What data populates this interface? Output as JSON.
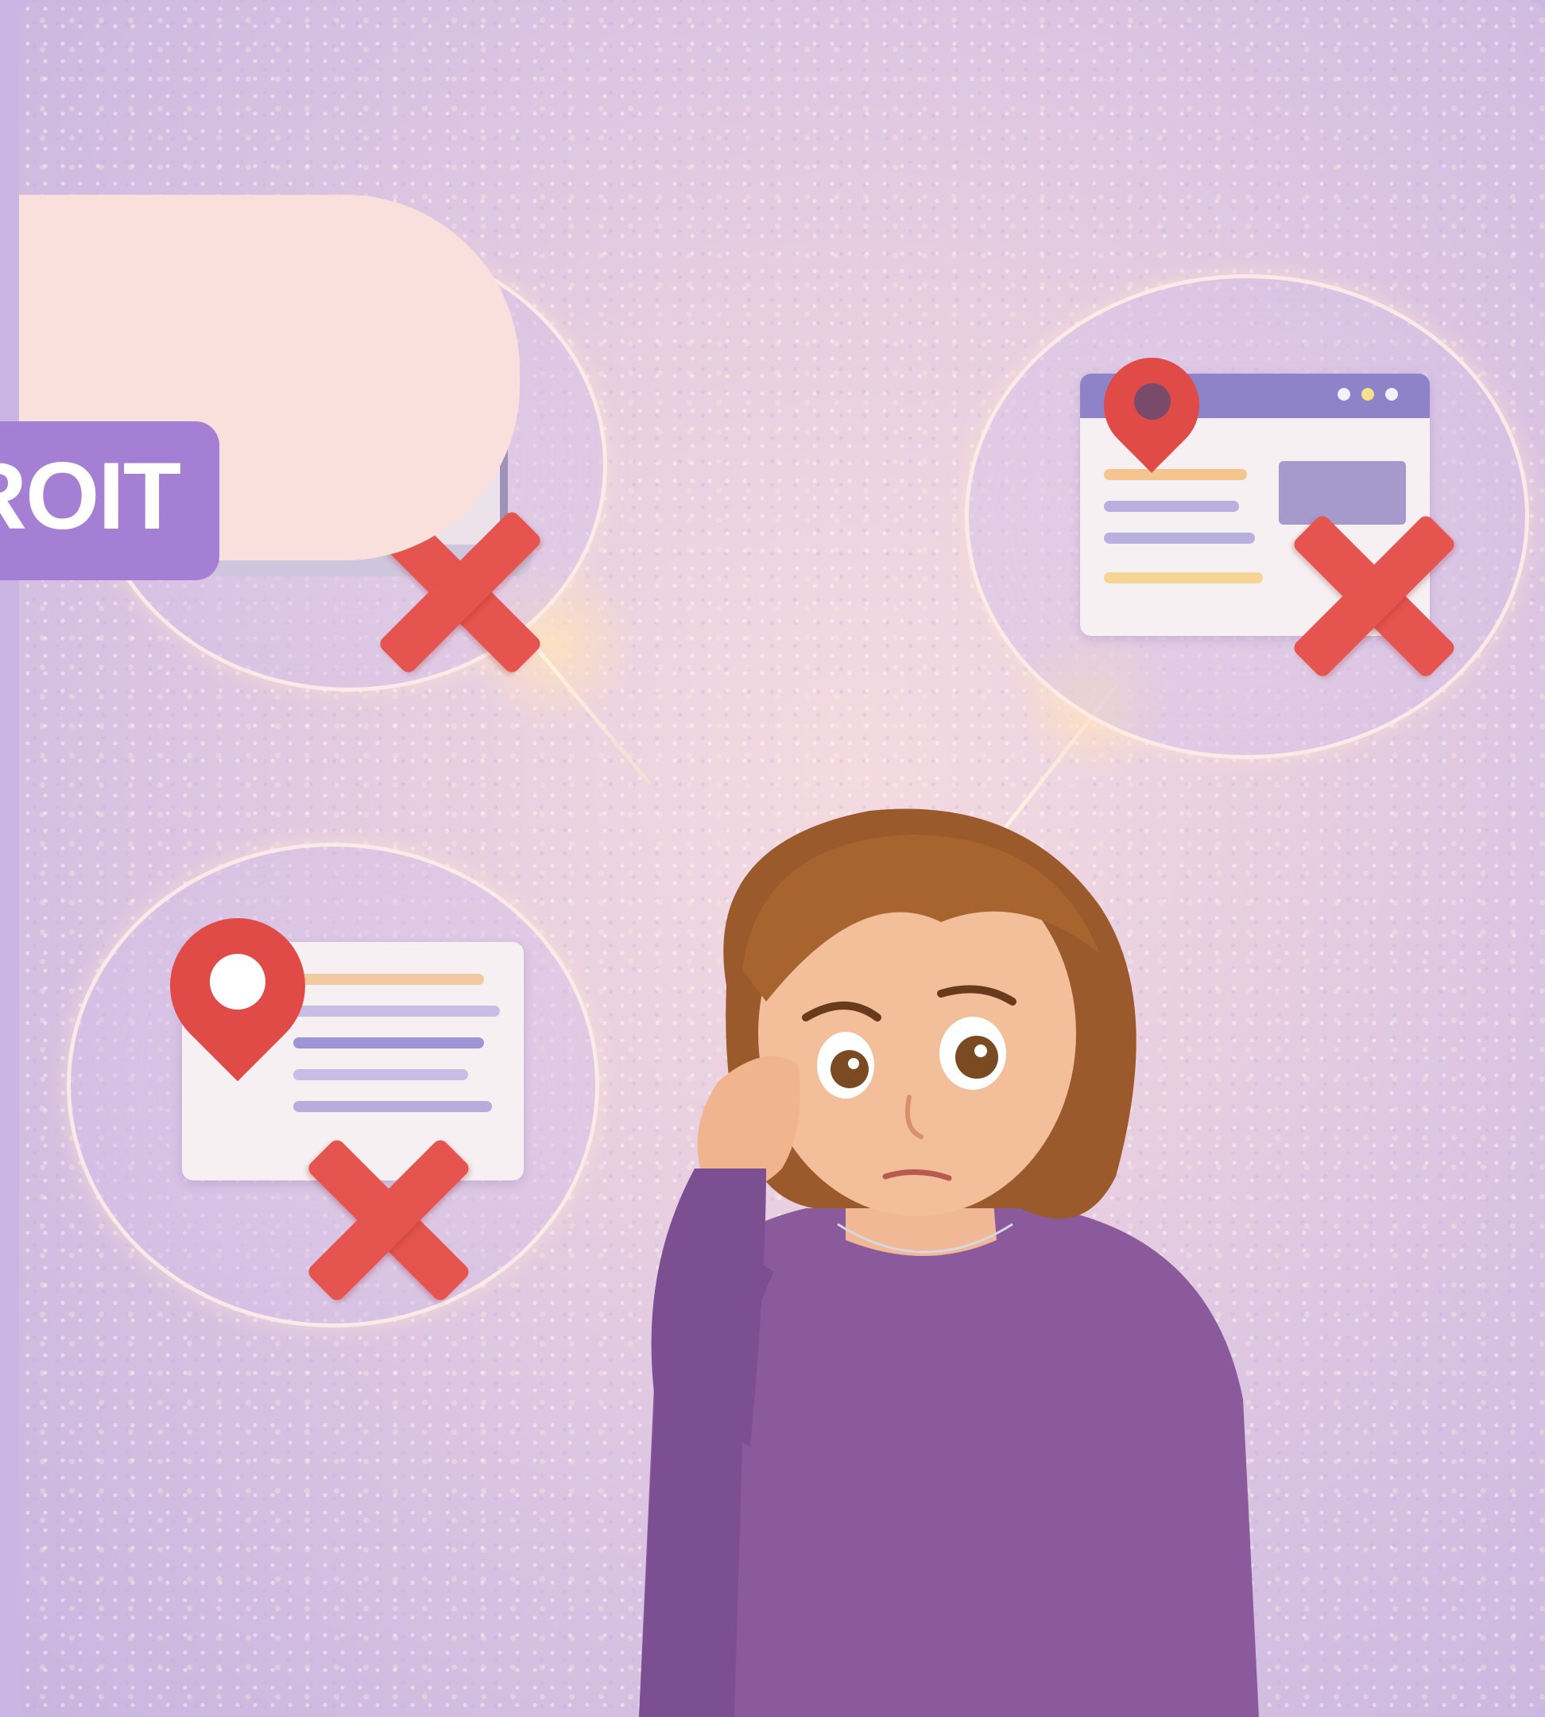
{
  "banner": {
    "label": "ROIT"
  },
  "illustration": {
    "subject": "woman-thinking",
    "icons": [
      "laptop-icon",
      "location-pin-icon",
      "browser-window-icon",
      "x-mark-icon"
    ]
  },
  "colors": {
    "accent": "#a57fd3",
    "highlight": "#f9e0dc",
    "x_mark": "#e5544e",
    "sweater": "#8a5a9c",
    "hair": "#9a5a2c"
  }
}
